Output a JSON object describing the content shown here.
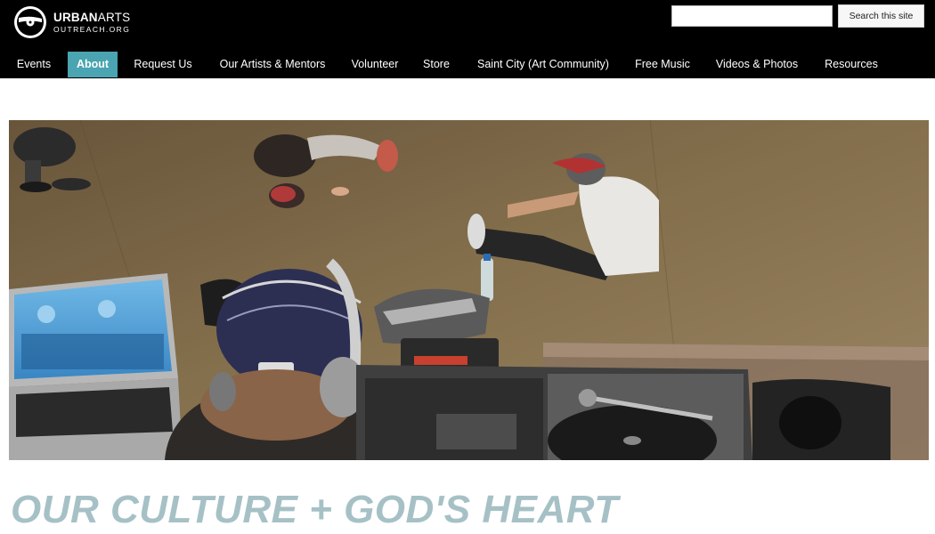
{
  "brand": {
    "name_bold": "URBAN",
    "name_light": "ARTS",
    "tagline": "OUTREACH.ORG"
  },
  "search": {
    "placeholder": "",
    "button_label": "Search this site"
  },
  "nav": {
    "items": [
      {
        "label": "Events"
      },
      {
        "label": "About",
        "active": true
      },
      {
        "label": "Request Us"
      },
      {
        "label": "Our Artists & Mentors"
      },
      {
        "label": "Volunteer"
      },
      {
        "label": "Store"
      },
      {
        "label": "Saint City (Art Community)"
      },
      {
        "label": "Free Music"
      },
      {
        "label": "Videos & Photos"
      },
      {
        "label": "Resources"
      }
    ]
  },
  "main": {
    "headline": "OUR CULTURE + GOD'S HEART"
  },
  "colors": {
    "header_bg": "#000000",
    "nav_active": "#4aa4b1",
    "headline": "#a6c1c6"
  }
}
